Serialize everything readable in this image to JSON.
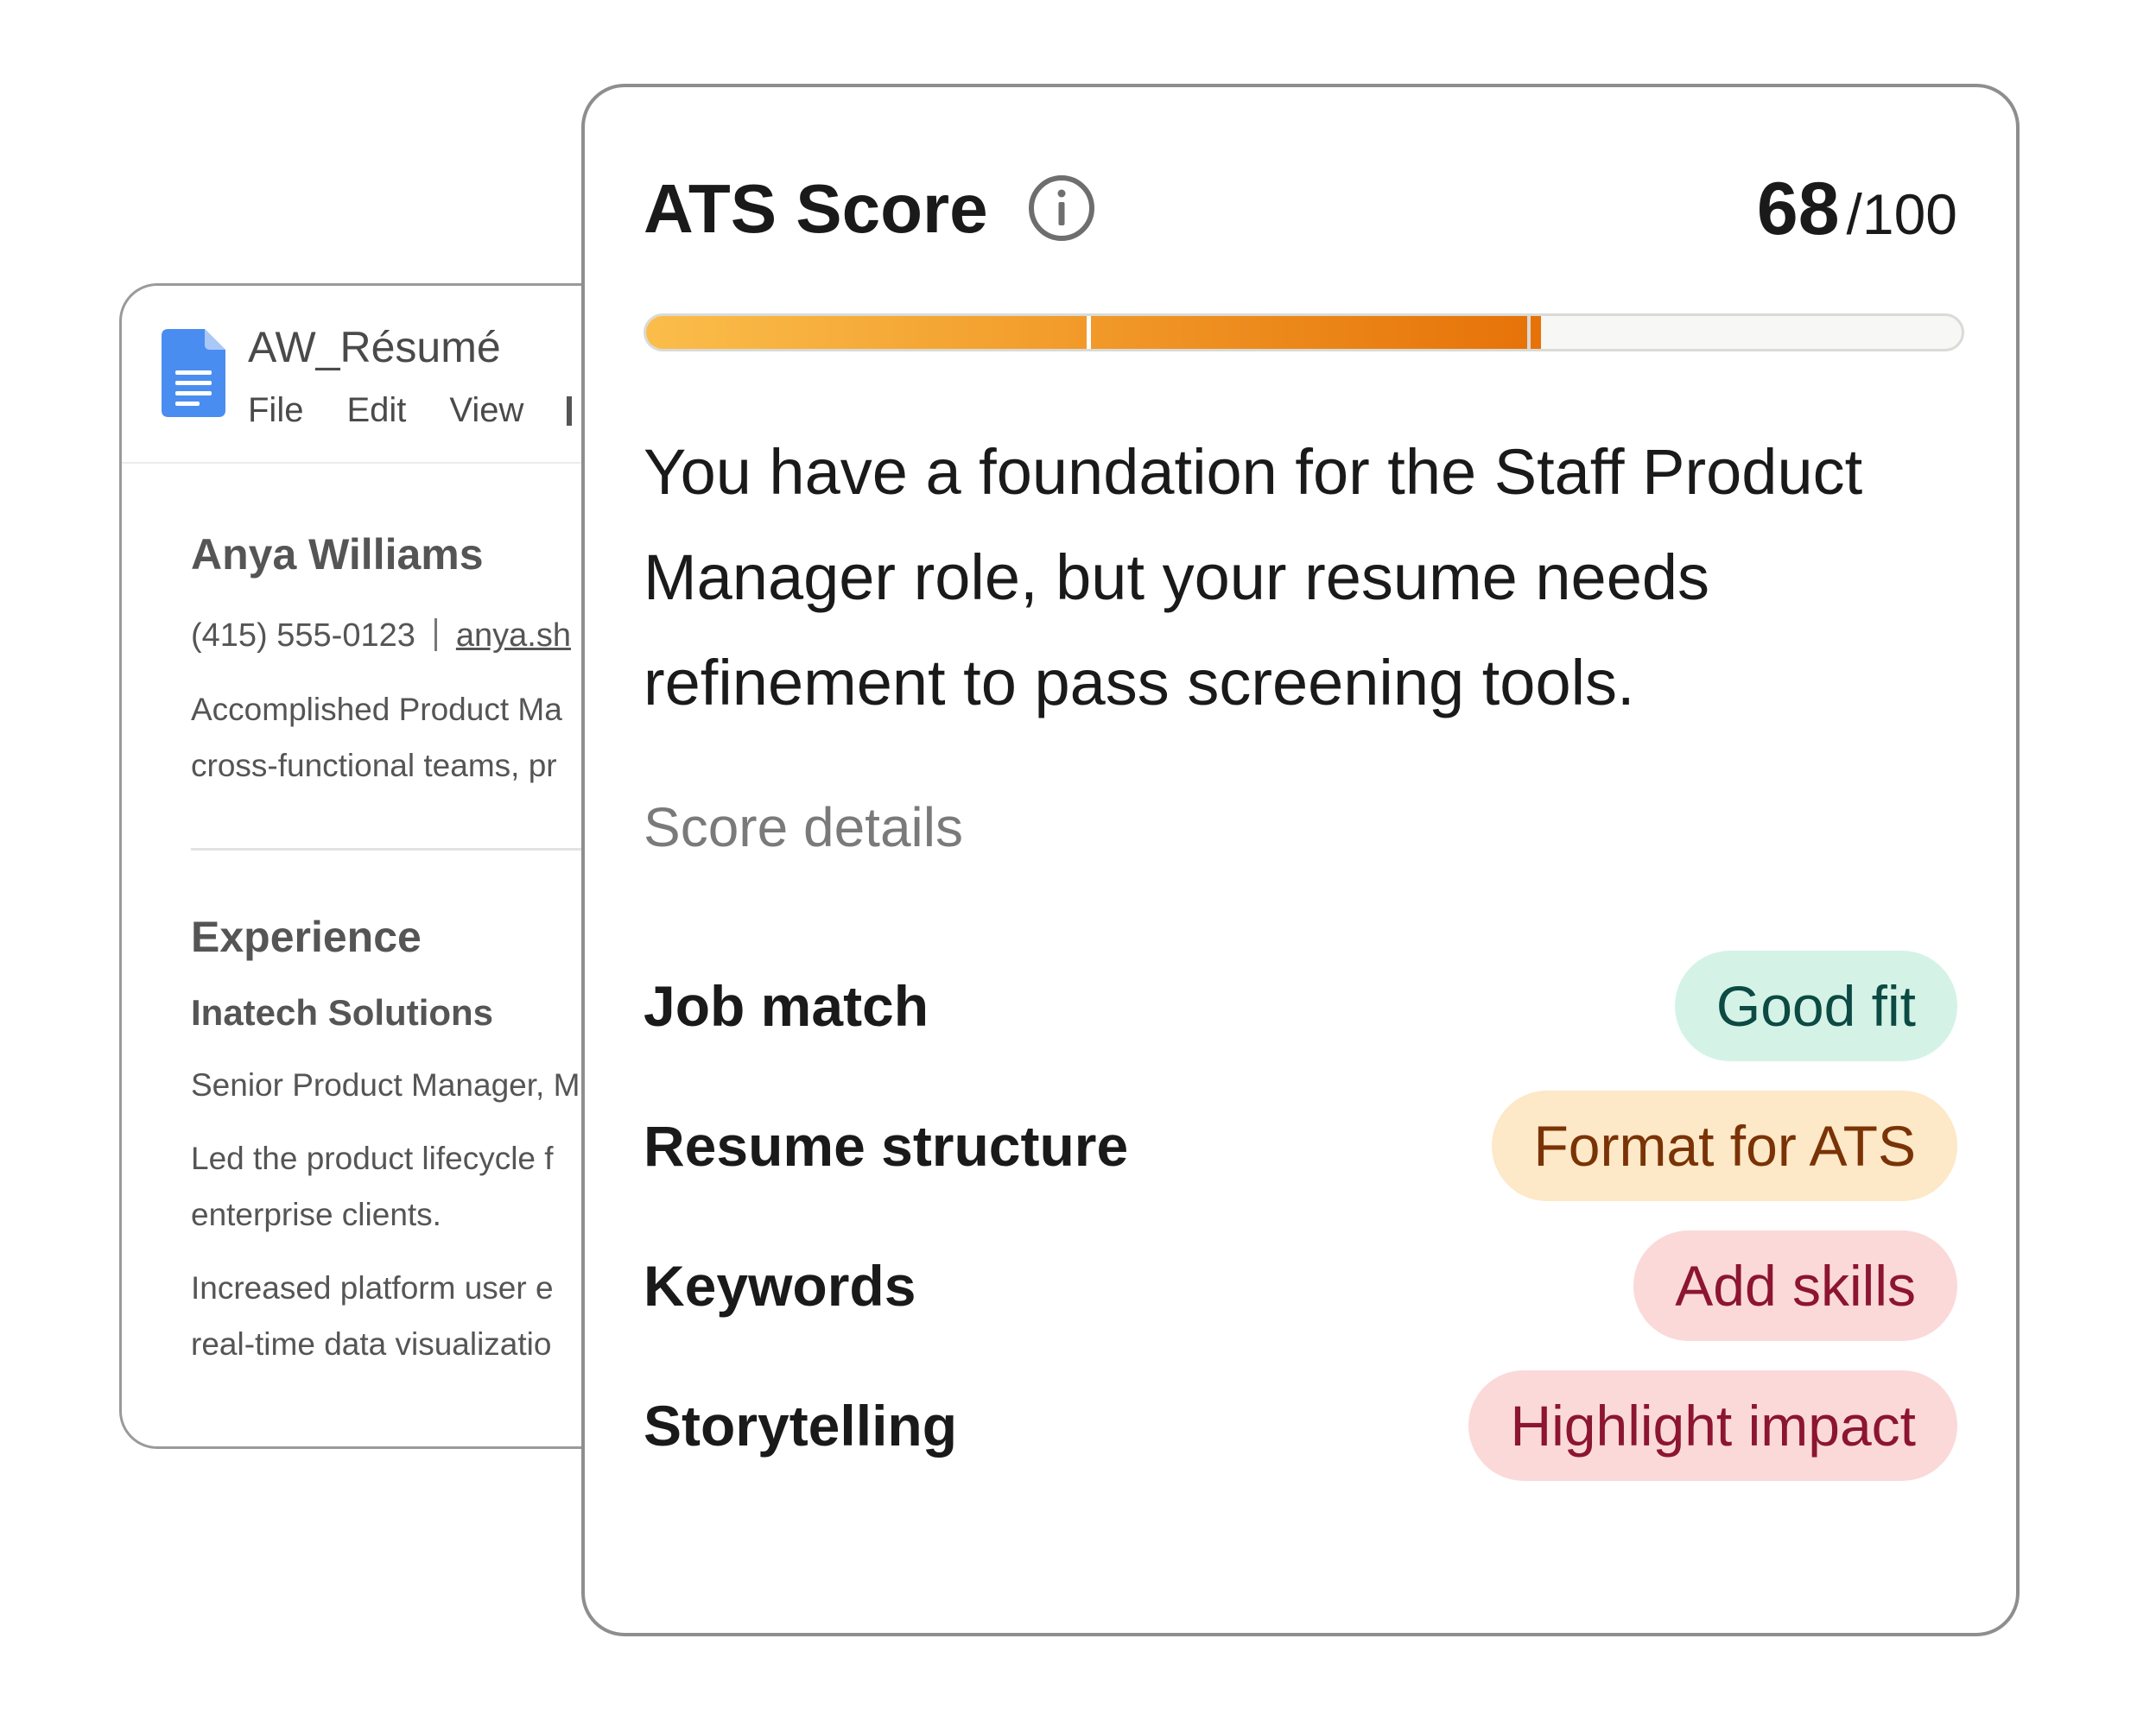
{
  "doc": {
    "title": "AW_Résumé",
    "menu": [
      "File",
      "Edit",
      "View"
    ],
    "name": "Anya Williams",
    "phone": "(415) 555-0123",
    "link": "anya.sh",
    "summary_line1": "Accomplished Product Ma",
    "summary_line2": "cross-functional teams, pr",
    "experience_heading": "Experience",
    "company": "Inatech Solutions",
    "role": "Senior Product Manager, M",
    "bullet1_line1": "Led the product lifecycle f",
    "bullet1_line2": "enterprise clients.",
    "bullet2_line1": "Increased platform user e",
    "bullet2_line2": "real-time data visualizatio"
  },
  "ats": {
    "title": "ATS Score",
    "score": "68",
    "score_max": "/100",
    "progress_fraction": 0.68,
    "summary": "You have a foundation for the Staff Product Manager role, but your resume needs refinement to pass screening tools.",
    "details_heading": "Score details",
    "details": [
      {
        "label": "Job match",
        "status": "Good fit",
        "bg": "#d4f3e6",
        "fg": "#0c4a43"
      },
      {
        "label": "Resume structure",
        "status": "Format for ATS",
        "bg": "#fde8c7",
        "fg": "#7a3306"
      },
      {
        "label": "Keywords",
        "status": "Add skills",
        "bg": "#fbd9d9",
        "fg": "#8c1530"
      },
      {
        "label": "Storytelling",
        "status": "Highlight impact",
        "bg": "#fbd9d9",
        "fg": "#8c1530"
      }
    ]
  },
  "colors": {
    "bar_start": "#fbbd4a",
    "bar_end": "#e67208",
    "doc_icon": "#4a8df0"
  },
  "icons": [
    "doc-icon",
    "info-icon"
  ]
}
